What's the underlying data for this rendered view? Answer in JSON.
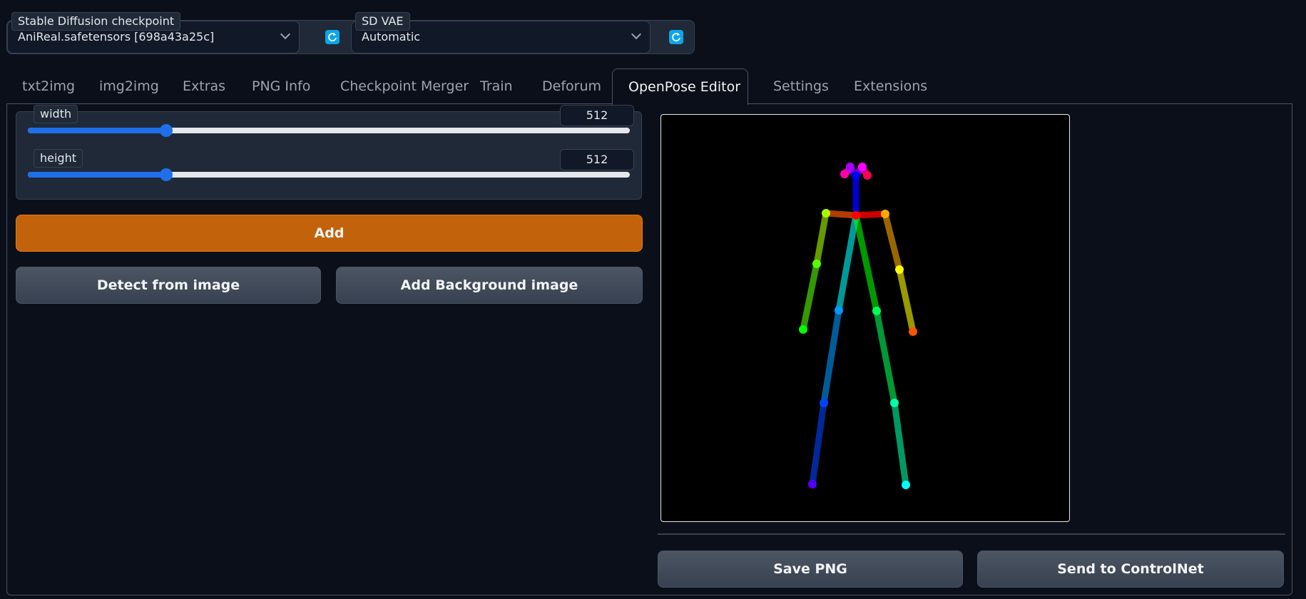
{
  "top": {
    "checkpoint_label": "Stable Diffusion checkpoint",
    "checkpoint_value": "AniReal.safetensors [698a43a25c]",
    "vae_label": "SD VAE",
    "vae_value": "Automatic",
    "refresh_icon": "refresh-icon"
  },
  "tabs": [
    "txt2img",
    "img2img",
    "Extras",
    "PNG Info",
    "Checkpoint Merger",
    "Train",
    "Deforum",
    "OpenPose Editor",
    "Settings",
    "Extensions"
  ],
  "active_tab": "OpenPose Editor",
  "sliders": {
    "width": {
      "label": "width",
      "value": "512",
      "fraction": 0.23
    },
    "height": {
      "label": "height",
      "value": "512",
      "fraction": 0.23
    }
  },
  "buttons": {
    "add": "Add",
    "detect": "Detect from image",
    "add_background": "Add Background image",
    "save_png": "Save PNG",
    "send_controlnet": "Send to ControlNet"
  },
  "colors": {
    "accent_orange": "#c2620a",
    "slider_blue": "#1f6feb",
    "refresh_blue": "#0ea5e9"
  }
}
